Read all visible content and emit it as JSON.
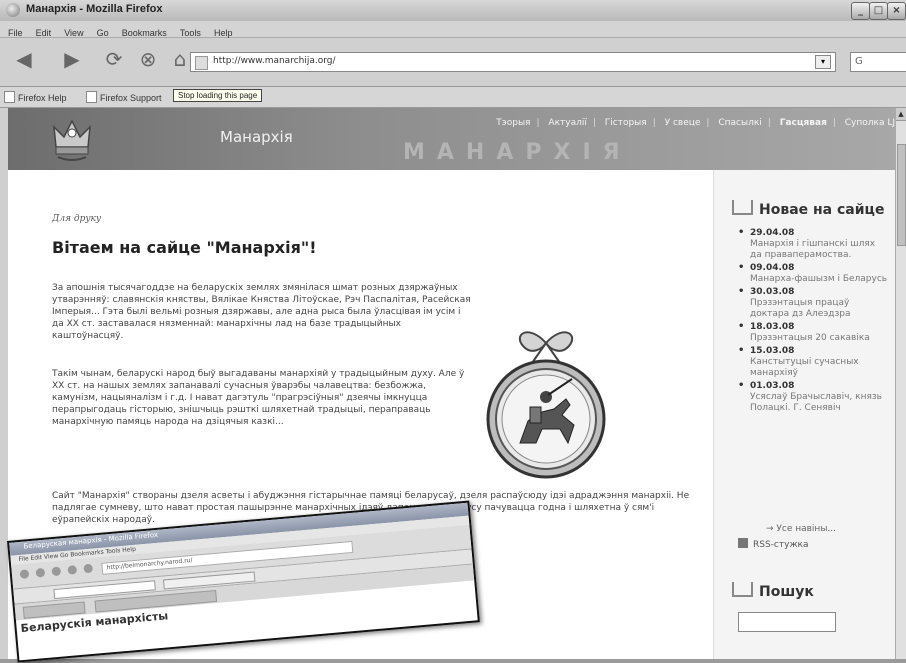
{
  "window": {
    "title": "Манархія - Mozilla Firefox"
  },
  "menu": [
    "File",
    "Edit",
    "View",
    "Go",
    "Bookmarks",
    "Tools",
    "Help"
  ],
  "nav": {
    "url": "http://www.manarchija.org/",
    "search_icon": "G"
  },
  "bookmarks": [
    "Firefox Help",
    "Firefox Support"
  ],
  "tooltip": "Stop loading this page",
  "site": {
    "name": "Манархія",
    "nav_items": [
      "Тэорыя",
      "Актуалії",
      "Гісторыя",
      "У свеце",
      "Спасылкі",
      "Гасцявая",
      "Суполка LJ"
    ],
    "banner_watermark": "МАНАРХІЯ"
  },
  "article": {
    "kicker": "Для друку",
    "title": "Вітаем на сайце \"Манархія\"!",
    "paragraphs": [
      "За апошнія тысячагоддзе на беларускіх землях змянілася шмат розных дзяржаўных утварэнняў: славянскія княствы, Вялікае Княства Літоўскае, Рэч Паспалітая, Расейская Імперыя... Гэта былі вельмі розныя дзяржавы, але адна рыса была ўласцівая ім усім і да XX ст. заставалася нязменнай: манархічны лад на базе традыцыйных каштоўнасцяў.",
      "Такім чынам, беларускі народ быў выгадаваны манархіяй у традыцыйным духу. Але ў XX ст. на нашых землях запанавалі сучасныя ўварэбы чалавецтва: безбожжа, камунізм, нацыяналізм і г.д. І нават дагэтуль \"прагрэсіўныя\" дзеячы імкнуцца перапрыгодаць гісторыю, знішчыць рэшткі шляхетнай традыцыі, пераправаць манархічную памяць народа на дзіцячыя казкі...",
      "Сайт \"Манархія\" створаны дзеля асветы і абуджэння гістарычнае памяці беларусаў, дзеля распаўсюду ідэі адраджэння манархіі. Не падлягае сумневу, што нават простая пашырэнне манархічных ідэяў дапаможа беларусу пачувацца годна і шляхетна ў сям'і еўрапейскіх народаў."
    ]
  },
  "sidebar": {
    "news_title": "Новае на сайце",
    "news": [
      {
        "date": "29.04.08",
        "title": "Манархія і гішпанскі шлях да праваперамоства."
      },
      {
        "date": "09.04.08",
        "title": "Манарха-фашызм і Беларусь"
      },
      {
        "date": "30.03.08",
        "title": "Прэзэнтацыя працаў доктара дз Алеэдзра"
      },
      {
        "date": "18.03.08",
        "title": "Прэзэнтацыя 20 сакавіка"
      },
      {
        "date": "15.03.08",
        "title": "Канстытуцыі сучасных манархіяў"
      },
      {
        "date": "01.03.08",
        "title": "Усяслаў Брачыславіч, князь Полацкі. Г. Сенявіч"
      }
    ],
    "more": "→ Усе навіны...",
    "rss": "RSS-стужка",
    "search_title": "Пошук"
  },
  "inset": {
    "window_title": "Беларуская манархія - Mozilla Firefox",
    "menu": "File  Edit  View  Go  Bookmarks  Tools  Help",
    "url": "http://belmonarchy.narod.ru/",
    "heading": "Беларускія манархісты"
  },
  "colors": {
    "banner_dark": "#6d6d6d",
    "banner_light": "#a8a8a8",
    "inset_titlebar": "#8a94a8"
  }
}
